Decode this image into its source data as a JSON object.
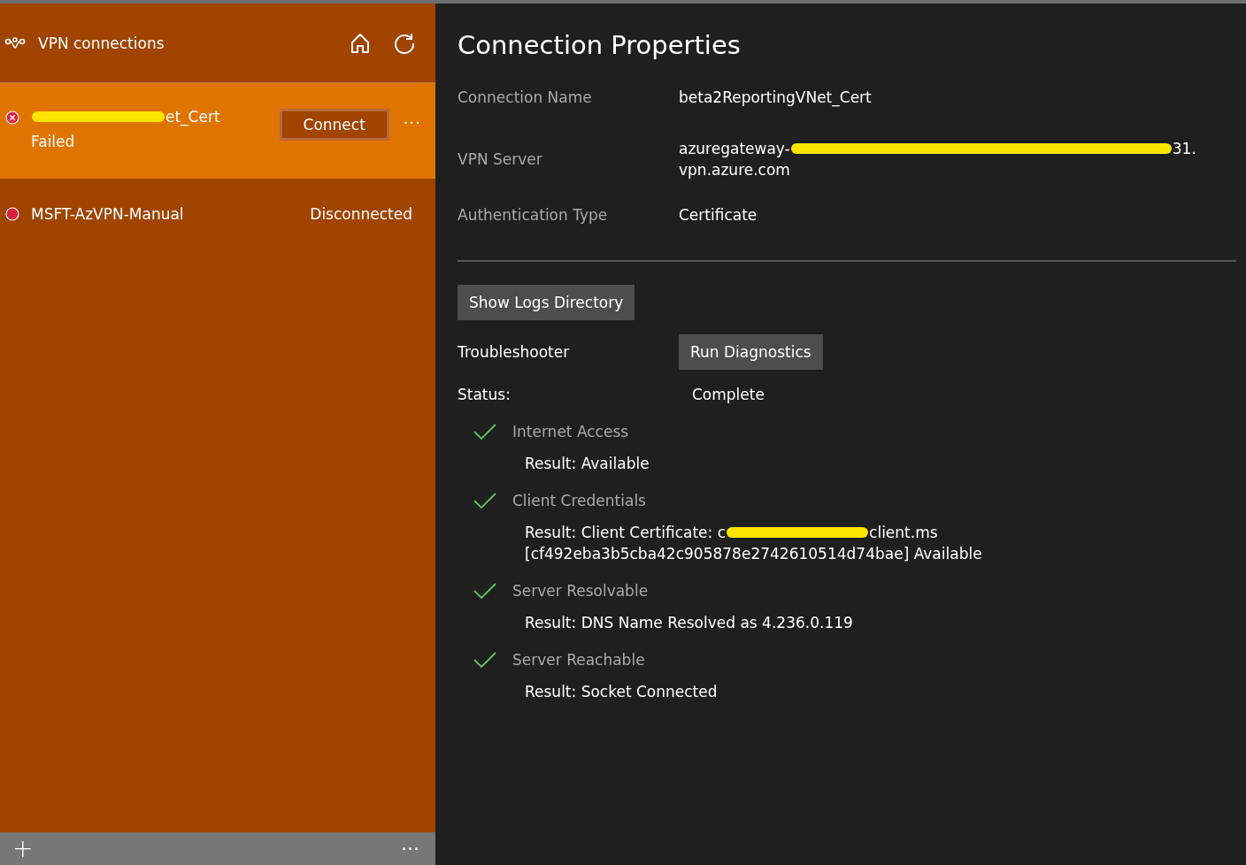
{
  "sidebar": {
    "title": "VPN connections",
    "connections": [
      {
        "name": [
          {
            "kind": "redaction"
          },
          {
            "kind": "text",
            "text": "et_Cert"
          }
        ],
        "status": "Failed",
        "kind": "error",
        "selected": true,
        "button": "Connect",
        "more": "···"
      },
      {
        "name": [
          {
            "kind": "text",
            "text": "MSFT-AzVPN-Manual"
          }
        ],
        "status": "Disconnected",
        "kind": "dot",
        "selected": false
      }
    ],
    "footer": {
      "add": "+",
      "more": "···"
    }
  },
  "properties": {
    "title": "Connection Properties",
    "fields": [
      {
        "label": "Connection Name",
        "lines": [
          [
            {
              "kind": "text",
              "text": "beta2ReportingVNet_Cert"
            }
          ]
        ]
      },
      {
        "label": "VPN Server",
        "lines": [
          [
            {
              "kind": "text",
              "text": "azuregateway-"
            },
            {
              "kind": "redaction"
            },
            {
              "kind": "text",
              "text": "31."
            }
          ],
          [
            {
              "kind": "text",
              "text": "vpn.azure.com"
            }
          ]
        ]
      },
      {
        "label": "Authentication Type",
        "lines": [
          [
            {
              "kind": "text",
              "text": "Certificate"
            }
          ]
        ]
      }
    ],
    "logs_button": "Show Logs Directory",
    "troubleshooter": {
      "label": "Troubleshooter",
      "button": "Run Diagnostics"
    },
    "status": {
      "label": "Status:",
      "value": "Complete"
    },
    "checks": [
      {
        "name": "Internet Access",
        "passed": true,
        "lines": [
          [
            {
              "kind": "text",
              "text": "Result: Available"
            }
          ]
        ]
      },
      {
        "name": "Client Credentials",
        "passed": true,
        "lines": [
          [
            {
              "kind": "text",
              "text": "Result: Client Certificate: c"
            },
            {
              "kind": "redaction"
            },
            {
              "kind": "text",
              "text": "client.ms"
            }
          ],
          [
            {
              "kind": "text",
              "text": "[cf492eba3b5cba42c905878e2742610514d74bae] Available"
            }
          ]
        ]
      },
      {
        "name": "Server Resolvable",
        "passed": true,
        "lines": [
          [
            {
              "kind": "text",
              "text": "Result: DNS Name Resolved as 4.236.0.119"
            }
          ]
        ]
      },
      {
        "name": "Server Reachable",
        "passed": true,
        "lines": [
          [
            {
              "kind": "text",
              "text": "Result: Socket Connected"
            }
          ]
        ]
      }
    ]
  }
}
